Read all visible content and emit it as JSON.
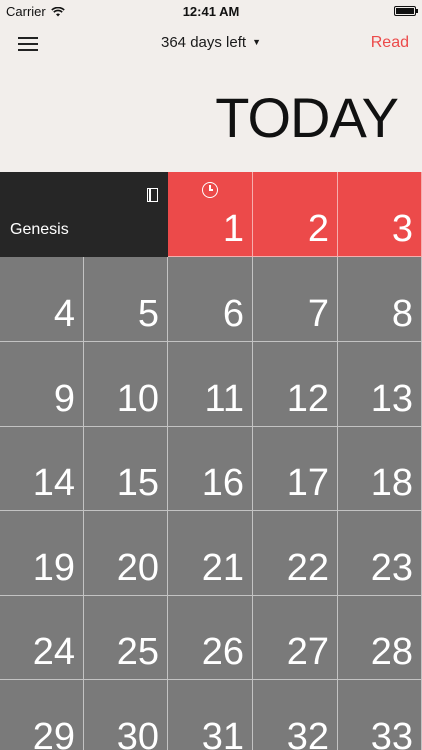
{
  "status_bar": {
    "carrier": "Carrier",
    "time": "12:41 AM",
    "wifi_icon": "wifi-icon",
    "battery_level": 1.0
  },
  "nav": {
    "days_left": "364 days left",
    "read_label": "Read",
    "menu_icon": "hamburger-menu-icon",
    "caret_icon": "dropdown-caret-icon"
  },
  "header": {
    "title": "TODAY"
  },
  "calendar": {
    "book": "Genesis",
    "highlight_days": [
      "1",
      "2",
      "3"
    ],
    "day_rows": [
      [
        "4",
        "5",
        "6",
        "7",
        "8"
      ],
      [
        "9",
        "10",
        "11",
        "12",
        "13"
      ],
      [
        "14",
        "15",
        "16",
        "17",
        "18"
      ],
      [
        "19",
        "20",
        "21",
        "22",
        "23"
      ],
      [
        "24",
        "25",
        "26",
        "27",
        "28"
      ],
      [
        "29",
        "30",
        "31",
        "32",
        "33"
      ]
    ]
  },
  "colors": {
    "accent": "#ec4a4a",
    "gray_cell": "#7a7a7a",
    "dark_cell": "#262626",
    "background": "#f2eeeb"
  }
}
